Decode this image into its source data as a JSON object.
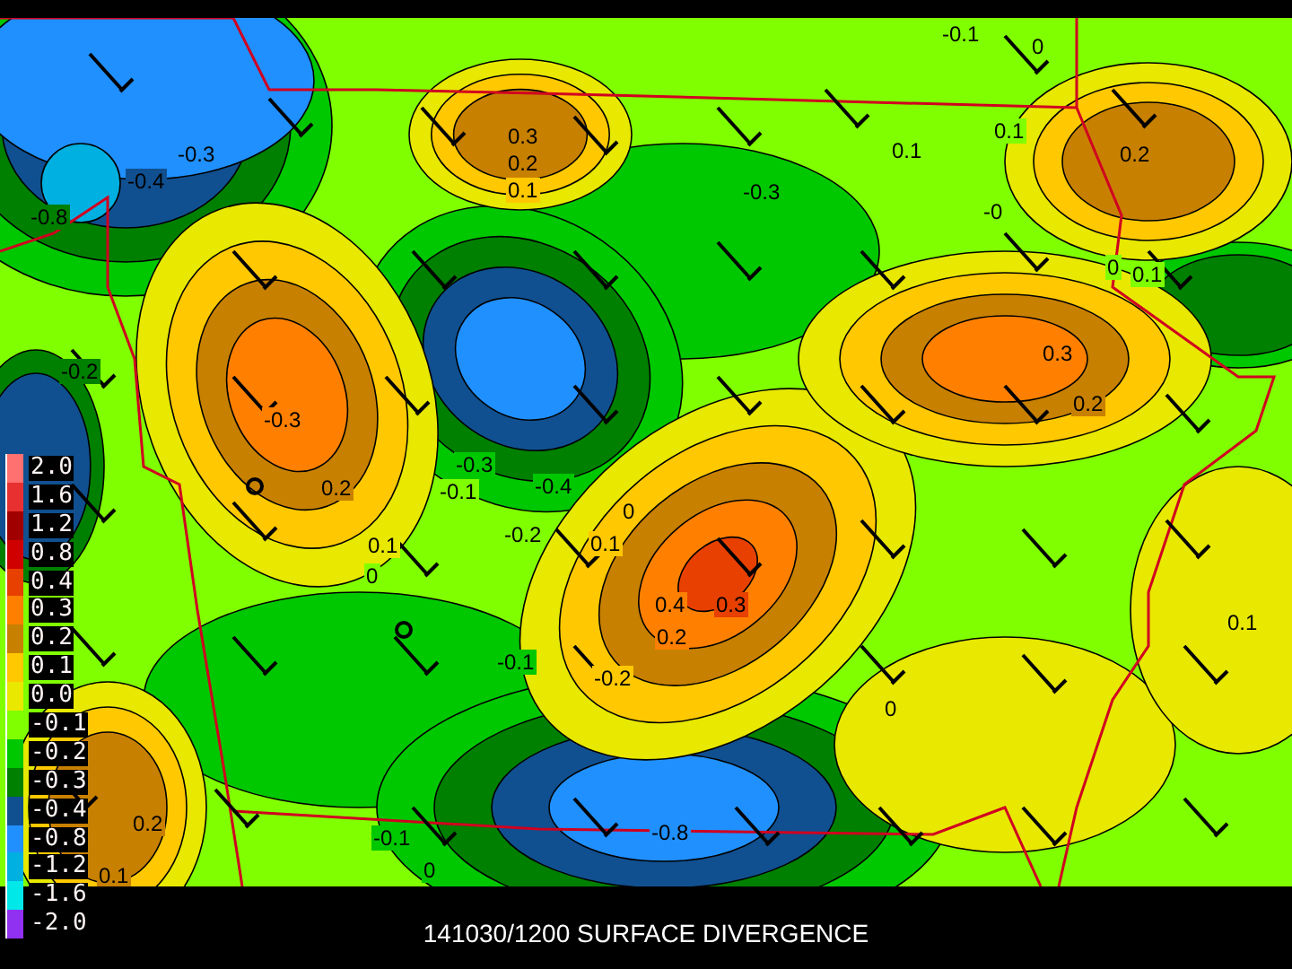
{
  "title": "141030/1200 SURFACE DIVERGENCE",
  "legend": [
    {
      "label": "2.0",
      "color": "#ff7070"
    },
    {
      "label": "1.6",
      "color": "#e83030"
    },
    {
      "label": "1.2",
      "color": "#a00000"
    },
    {
      "label": "0.8",
      "color": "#d00000"
    },
    {
      "label": "0.4",
      "color": "#e84000"
    },
    {
      "label": "0.3",
      "color": "#ff8000"
    },
    {
      "label": "0.2",
      "color": "#c88000"
    },
    {
      "label": "0.1",
      "color": "#ffc800"
    },
    {
      "label": "0.0",
      "color": "#e8e800"
    },
    {
      "label": "-0.1",
      "color": "#80ff00"
    },
    {
      "label": "-0.2",
      "color": "#00c800"
    },
    {
      "label": "-0.3",
      "color": "#008000"
    },
    {
      "label": "-0.4",
      "color": "#105090"
    },
    {
      "label": "-0.8",
      "color": "#2090ff"
    },
    {
      "label": "-1.2",
      "color": "#00b0e0"
    },
    {
      "label": "-1.6",
      "color": "#00e8e8"
    },
    {
      "label": "-2.0",
      "color": "#9030f0"
    }
  ],
  "map": {
    "contour_labels": [
      "-0.1",
      "0",
      "0.3",
      "0.2",
      "0.1",
      "-0.3",
      "-0.4",
      "-0.8",
      "0.1",
      "0.1",
      "0.2",
      "-0.3",
      "-0",
      "0",
      "0.1",
      "-0.2",
      "-0.3",
      "0.3",
      "0.2",
      "0.2",
      "-0.3",
      "-0.1",
      "-0.4",
      "0",
      "0.1",
      "-0.2",
      "0.1",
      "0",
      "0.4",
      "0.3",
      "0.2",
      "-0.1",
      "-0.2",
      "0.1",
      "0",
      "0.2",
      "0.1",
      "-0.1",
      "0",
      "-0.8"
    ]
  }
}
